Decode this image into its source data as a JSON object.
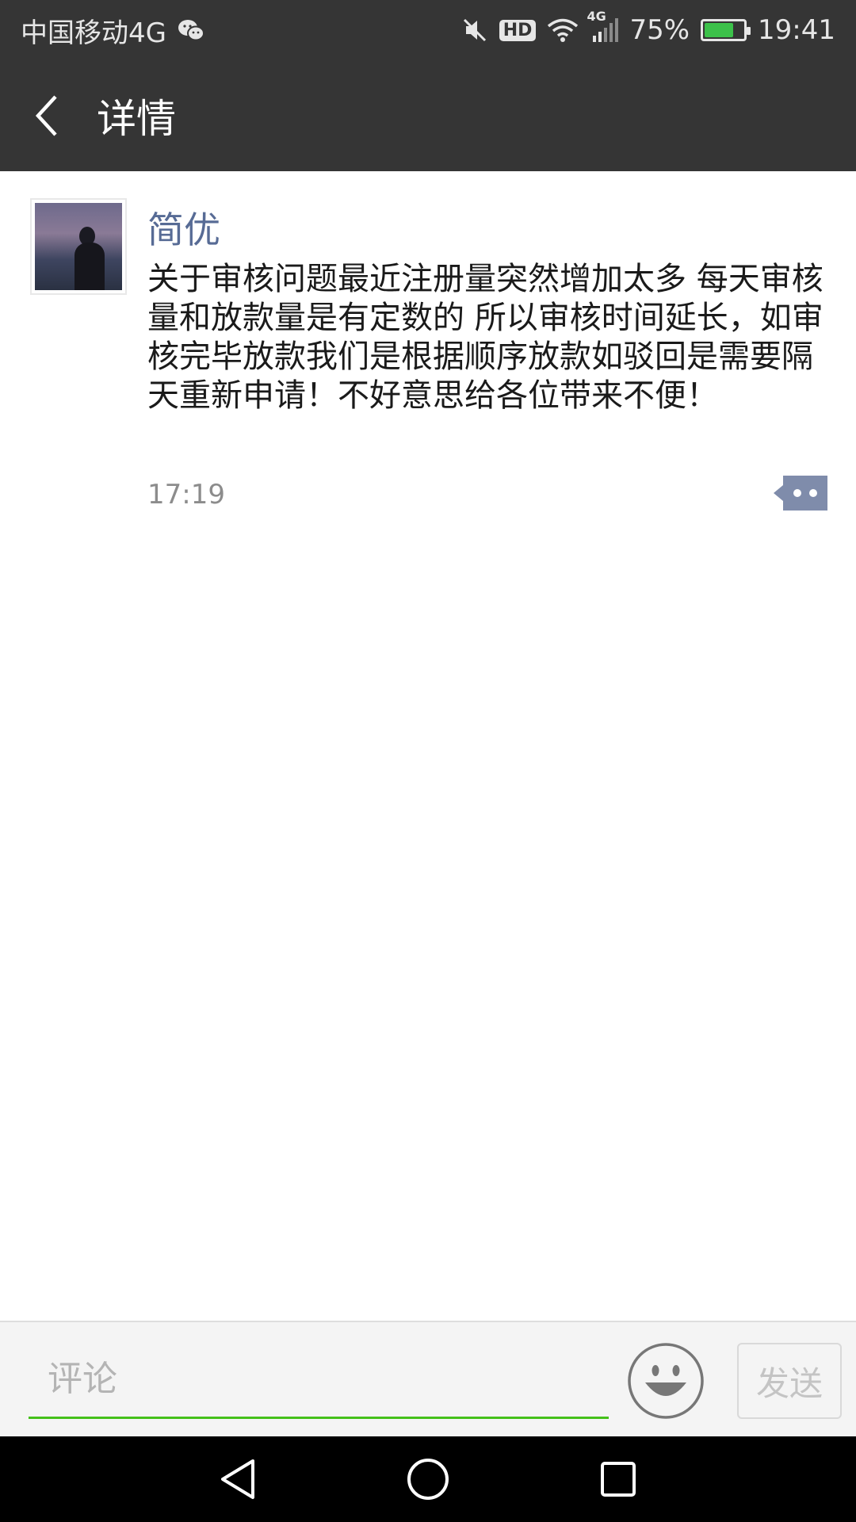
{
  "status_bar": {
    "carrier": "中国移动4G",
    "hd": "HD",
    "network": "4G",
    "battery_percent": "75%",
    "battery_level": 0.75,
    "time": "19:41",
    "icons": [
      "wechat-icon",
      "mute-icon",
      "wifi-icon",
      "signal-icon",
      "battery-icon"
    ]
  },
  "header": {
    "title": "详情"
  },
  "post": {
    "author": "简优",
    "text": "关于审核问题最近注册量突然增加太多 每天审核量和放款量是有定数的 所以审核时间延长，如审核完毕放款我们是根据顺序放款如驳回是需要隔天重新申请！不好意思给各位带来不便！",
    "time": "17:19"
  },
  "comment_bar": {
    "placeholder": "评论",
    "send_label": "发送"
  },
  "colors": {
    "header_bg": "#353535",
    "author_link": "#576b95",
    "input_underline": "#45c01a",
    "nav_bg": "#000000"
  }
}
